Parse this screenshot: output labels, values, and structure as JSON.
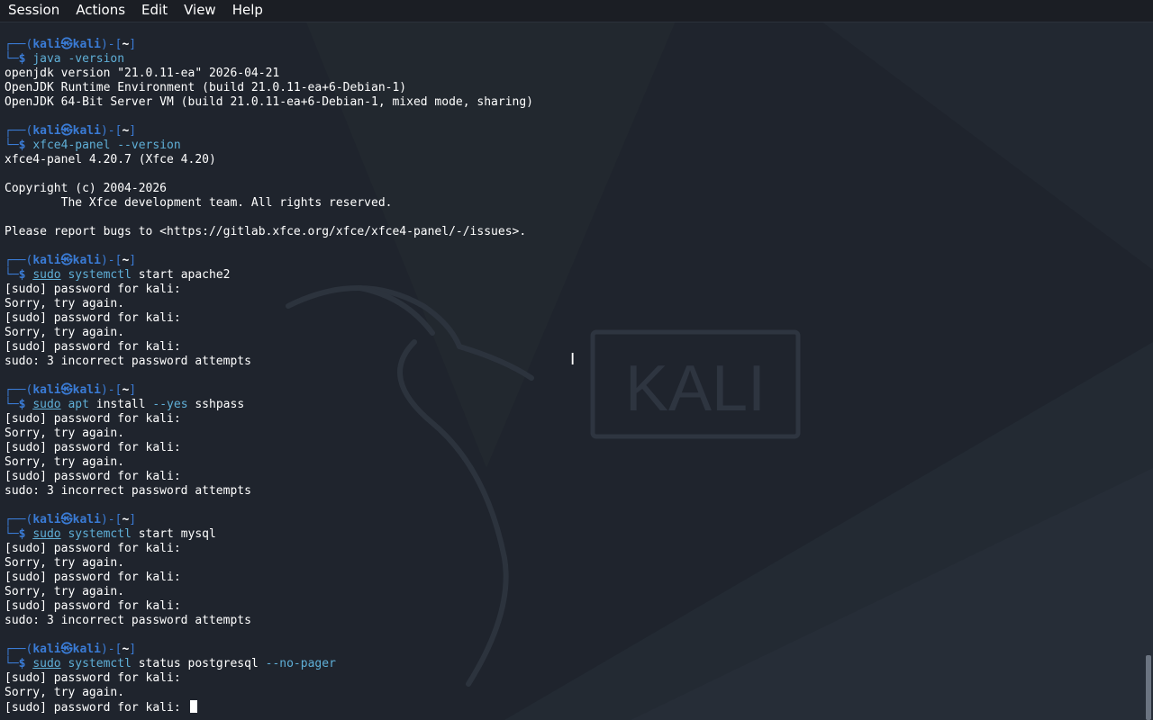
{
  "menubar": {
    "items": [
      "Session",
      "Actions",
      "Edit",
      "View",
      "Help"
    ]
  },
  "wallpaper": {
    "logo_text": "KALI"
  },
  "colors": {
    "background": "#1f242d",
    "prompt_blue": "#3a7bd5",
    "command_cyan": "#5fafd7",
    "text": "#ffffff"
  },
  "prompt": {
    "frame_top_left": "┌──(",
    "user": "kali",
    "at": "㉿",
    "host": "kali",
    "mid": ")-[",
    "dir": "~",
    "end": "]",
    "frame_bottom": "└─",
    "dollar": "$"
  },
  "blocks": [
    {
      "command_parts": [
        {
          "text": "java",
          "style": "cmd"
        },
        {
          "text": " -version",
          "style": "arg"
        }
      ],
      "output": [
        "openjdk version \"21.0.11-ea\" 2026-04-21",
        "OpenJDK Runtime Environment (build 21.0.11-ea+6-Debian-1)",
        "OpenJDK 64-Bit Server VM (build 21.0.11-ea+6-Debian-1, mixed mode, sharing)"
      ]
    },
    {
      "command_parts": [
        {
          "text": "xfce4-panel",
          "style": "cmd"
        },
        {
          "text": " --version",
          "style": "arg"
        }
      ],
      "output": [
        "xfce4-panel 4.20.7 (Xfce 4.20)",
        "",
        "Copyright (c) 2004-2026",
        "        The Xfce development team. All rights reserved.",
        "",
        "Please report bugs to <https://gitlab.xfce.org/xfce/xfce4-panel/-/issues>."
      ]
    },
    {
      "command_parts": [
        {
          "text": "sudo",
          "style": "sudo"
        },
        {
          "text": " ",
          "style": "plain"
        },
        {
          "text": "systemctl",
          "style": "cmd"
        },
        {
          "text": " start apache2",
          "style": "plain"
        }
      ],
      "output": [
        "[sudo] password for kali:",
        "Sorry, try again.",
        "[sudo] password for kali:",
        "Sorry, try again.",
        "[sudo] password for kali:",
        "sudo: 3 incorrect password attempts"
      ]
    },
    {
      "command_parts": [
        {
          "text": "sudo",
          "style": "sudo"
        },
        {
          "text": " ",
          "style": "plain"
        },
        {
          "text": "apt",
          "style": "cmd"
        },
        {
          "text": " install ",
          "style": "plain"
        },
        {
          "text": "--yes",
          "style": "arg"
        },
        {
          "text": " sshpass",
          "style": "plain"
        }
      ],
      "output": [
        "[sudo] password for kali:",
        "Sorry, try again.",
        "[sudo] password for kali:",
        "Sorry, try again.",
        "[sudo] password for kali:",
        "sudo: 3 incorrect password attempts"
      ]
    },
    {
      "command_parts": [
        {
          "text": "sudo",
          "style": "sudo"
        },
        {
          "text": " ",
          "style": "plain"
        },
        {
          "text": "systemctl",
          "style": "cmd"
        },
        {
          "text": " start mysql",
          "style": "plain"
        }
      ],
      "output": [
        "[sudo] password for kali:",
        "Sorry, try again.",
        "[sudo] password for kali:",
        "Sorry, try again.",
        "[sudo] password for kali:",
        "sudo: 3 incorrect password attempts"
      ]
    },
    {
      "command_parts": [
        {
          "text": "sudo",
          "style": "sudo"
        },
        {
          "text": " ",
          "style": "plain"
        },
        {
          "text": "systemctl",
          "style": "cmd"
        },
        {
          "text": " status postgresql ",
          "style": "plain"
        },
        {
          "text": "--no-pager",
          "style": "arg"
        }
      ],
      "output": [
        "[sudo] password for kali:",
        "Sorry, try again."
      ],
      "active_line": "[sudo] password for kali: "
    }
  ]
}
